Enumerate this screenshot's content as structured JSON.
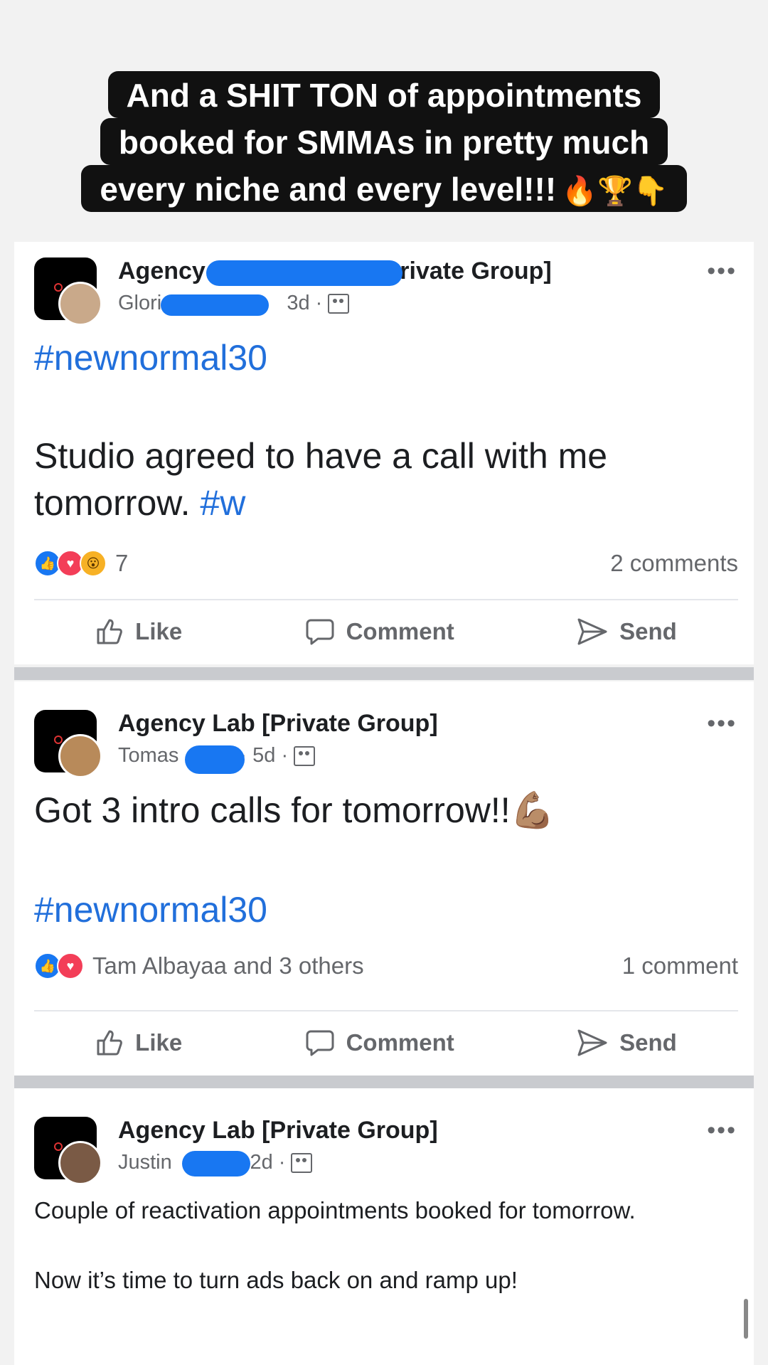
{
  "caption": {
    "line1": "And a SHIT TON of appointments",
    "line2": "booked for SMMAs in pretty much",
    "line3": "every niche and every level!!!",
    "emojis": "🔥🏆👇"
  },
  "posts": [
    {
      "group": "Agency ",
      "group_suffix": "[Private Group]",
      "author": "Gloria",
      "time": "3d ·",
      "hashtag_top": "#newnormal30",
      "text": "Studio agreed to have a call with me tomorrow.",
      "hashtag_inline": "#w",
      "reaction_count": "7",
      "comments": "2 comments"
    },
    {
      "group": "Agency Lab [Private Group]",
      "author": "Tomas",
      "time": "· 5d ·",
      "text": "Got 3 intro calls for tomorrow!!💪🏽",
      "hashtag": "#newnormal30",
      "reactors": "Tam Albayaa and 3 others",
      "comments": "1 comment"
    },
    {
      "group": "Agency Lab [Private Group]",
      "author": "Justin",
      "time": "· 2d ·",
      "text1": "Couple of reactivation appointments booked for tomorrow.",
      "text2": "Now it’s time to turn ads back on and ramp up!"
    }
  ],
  "actions": {
    "like": "Like",
    "comment": "Comment",
    "send": "Send"
  },
  "more": "•••",
  "colors": {
    "link": "#216fdb",
    "like": "#1877f2",
    "love": "#f33e58",
    "wow": "#f7b125",
    "redaction": "#1877f2"
  }
}
